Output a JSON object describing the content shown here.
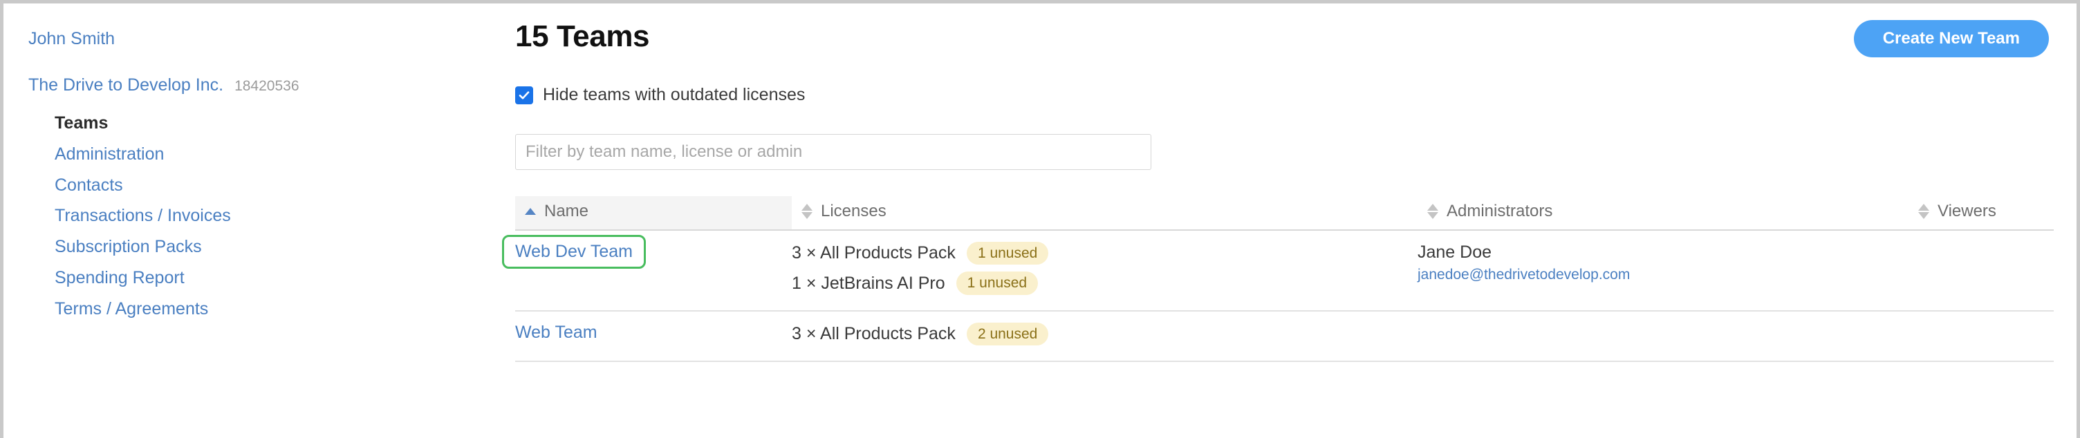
{
  "sidebar": {
    "user": "John Smith",
    "org": {
      "name": "The Drive to Develop Inc.",
      "account_id": "18420536"
    },
    "items": [
      {
        "label": "Teams",
        "active": true
      },
      {
        "label": "Administration",
        "active": false
      },
      {
        "label": "Contacts",
        "active": false
      },
      {
        "label": "Transactions / Invoices",
        "active": false
      },
      {
        "label": "Subscription Packs",
        "active": false
      },
      {
        "label": "Spending Report",
        "active": false
      },
      {
        "label": "Terms / Agreements",
        "active": false
      }
    ]
  },
  "header": {
    "title": "15 Teams",
    "create_button": "Create New Team"
  },
  "filters": {
    "hide_outdated_label": "Hide teams with outdated licenses",
    "hide_outdated_checked": true,
    "search_placeholder": "Filter by team name, license or admin",
    "search_value": ""
  },
  "table": {
    "columns": [
      {
        "label": "Name",
        "sort": "asc"
      },
      {
        "label": "Licenses",
        "sort": "none"
      },
      {
        "label": "Administrators",
        "sort": "none"
      },
      {
        "label": "Viewers",
        "sort": "none"
      }
    ],
    "rows": [
      {
        "name": "Web Dev Team",
        "focused": true,
        "licenses": [
          {
            "text": "3 × All Products Pack",
            "badge": "1 unused"
          },
          {
            "text": "1 × JetBrains AI Pro",
            "badge": "1 unused"
          }
        ],
        "admins": [
          {
            "name": "Jane Doe",
            "email": "janedoe@thedrivetodevelop.com"
          }
        ],
        "viewers": ""
      },
      {
        "name": "Web Team",
        "focused": false,
        "licenses": [
          {
            "text": "3 × All Products Pack",
            "badge": "2 unused"
          }
        ],
        "admins": [],
        "viewers": ""
      }
    ]
  },
  "colors": {
    "link": "#4a7fc1",
    "accent": "#4da3f5",
    "checkbox": "#1a73e8",
    "focus_ring": "#48bd5e",
    "badge_bg": "#faf0cd",
    "badge_text": "#8a7018"
  }
}
